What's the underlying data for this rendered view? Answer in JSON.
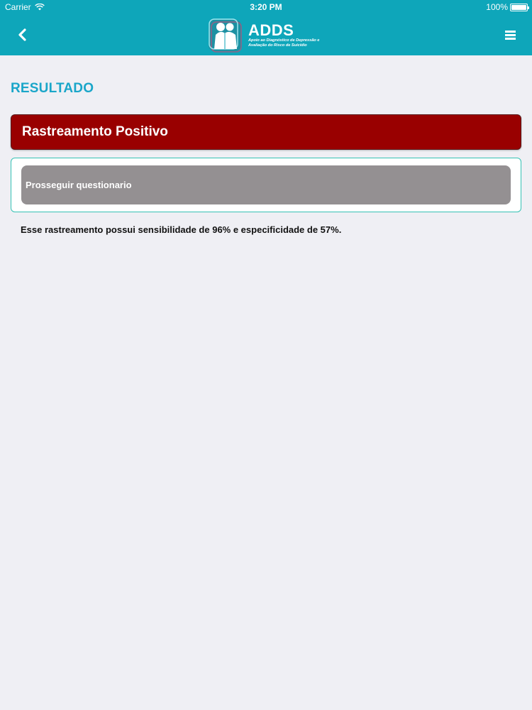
{
  "status_bar": {
    "carrier": "Carrier",
    "time": "3:20 PM",
    "battery": "100%"
  },
  "header": {
    "brand_name": "ADDS",
    "brand_subtitle": "Apoio ao Diagnóstico de Depressão e Avaliação do Risco de Suicídio",
    "icons": [
      "chevron-left-icon",
      "hamburger-menu-icon",
      "adds-logo"
    ],
    "colors": {
      "header_bg": "#0ea6ba"
    }
  },
  "main": {
    "title": "RESULTADO",
    "result_label": "Rastreamento Positivo",
    "continue_label": "Prosseguir questionario",
    "info": "Esse rastreamento possui sensibilidade de 96% e especificidade de 57%.",
    "colors": {
      "title": "#1aa6c9",
      "result_bg": "#990000",
      "button_bg": "#949092",
      "panel_border": "#35c2b4"
    }
  }
}
